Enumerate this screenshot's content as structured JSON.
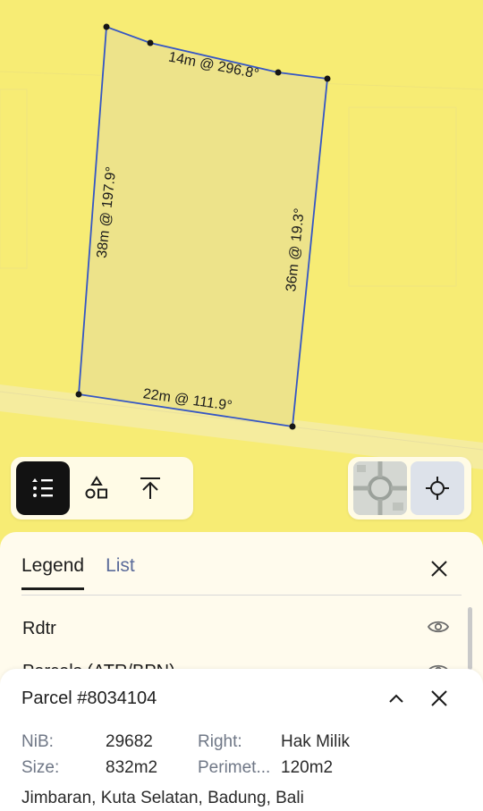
{
  "map": {
    "edges": {
      "top": "14m @ 296.8°",
      "left": "38m @ 197.9°",
      "right": "36m @ 19.3°",
      "bottom": "22m @ 111.9°"
    }
  },
  "toolbar": {
    "legend_icon": "list-icon",
    "shapes_icon": "shapes-icon",
    "export_icon": "upload-icon",
    "satellite_icon": "satellite-thumbnail",
    "locate_icon": "crosshair-icon"
  },
  "legend": {
    "tabs": [
      {
        "label": "Legend",
        "active": true
      },
      {
        "label": "List",
        "active": false
      }
    ],
    "rows": [
      {
        "label": "Rdtr"
      },
      {
        "label": "Parcels (ATR/BPN)"
      }
    ]
  },
  "parcel": {
    "title": "Parcel #8034104",
    "fields": {
      "nib_label": "NiB:",
      "nib_value": "29682",
      "right_label": "Right:",
      "right_value": "Hak Milik",
      "size_label": "Size:",
      "size_value": "832m2",
      "perimeter_label": "Perimet...",
      "perimeter_value": "120m2"
    },
    "address": "Jimbaran, Kuta Selatan, Badung, Bali"
  },
  "colors": {
    "map_background": "#f7ec74",
    "parcel_fill": "#ede38a",
    "parcel_stroke": "#3556c4",
    "panel_bg": "#fffbed"
  }
}
